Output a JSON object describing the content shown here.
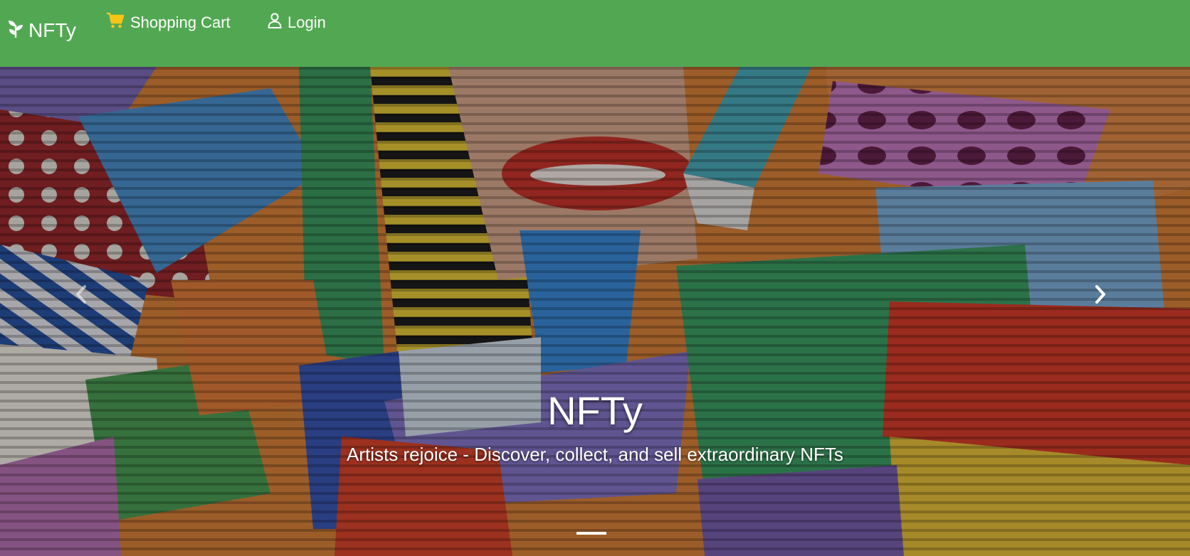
{
  "navbar": {
    "brand_label": "NFTy",
    "brand_icon": "leaf-sprout-icon",
    "cart_label": "Shopping Cart",
    "cart_icon": "shopping-cart-icon",
    "login_label": "Login",
    "login_icon": "user-icon",
    "background_color": "#52a852",
    "cart_icon_color": "#f5c518"
  },
  "carousel": {
    "slide": {
      "title": "NFTy",
      "subtitle": "Artists rejoice - Discover, collect, and sell extraordinary NFTs"
    },
    "prev_icon": "chevron-left-icon",
    "next_icon": "chevron-right-icon",
    "indicator_count": 1,
    "active_indicator": 1
  }
}
